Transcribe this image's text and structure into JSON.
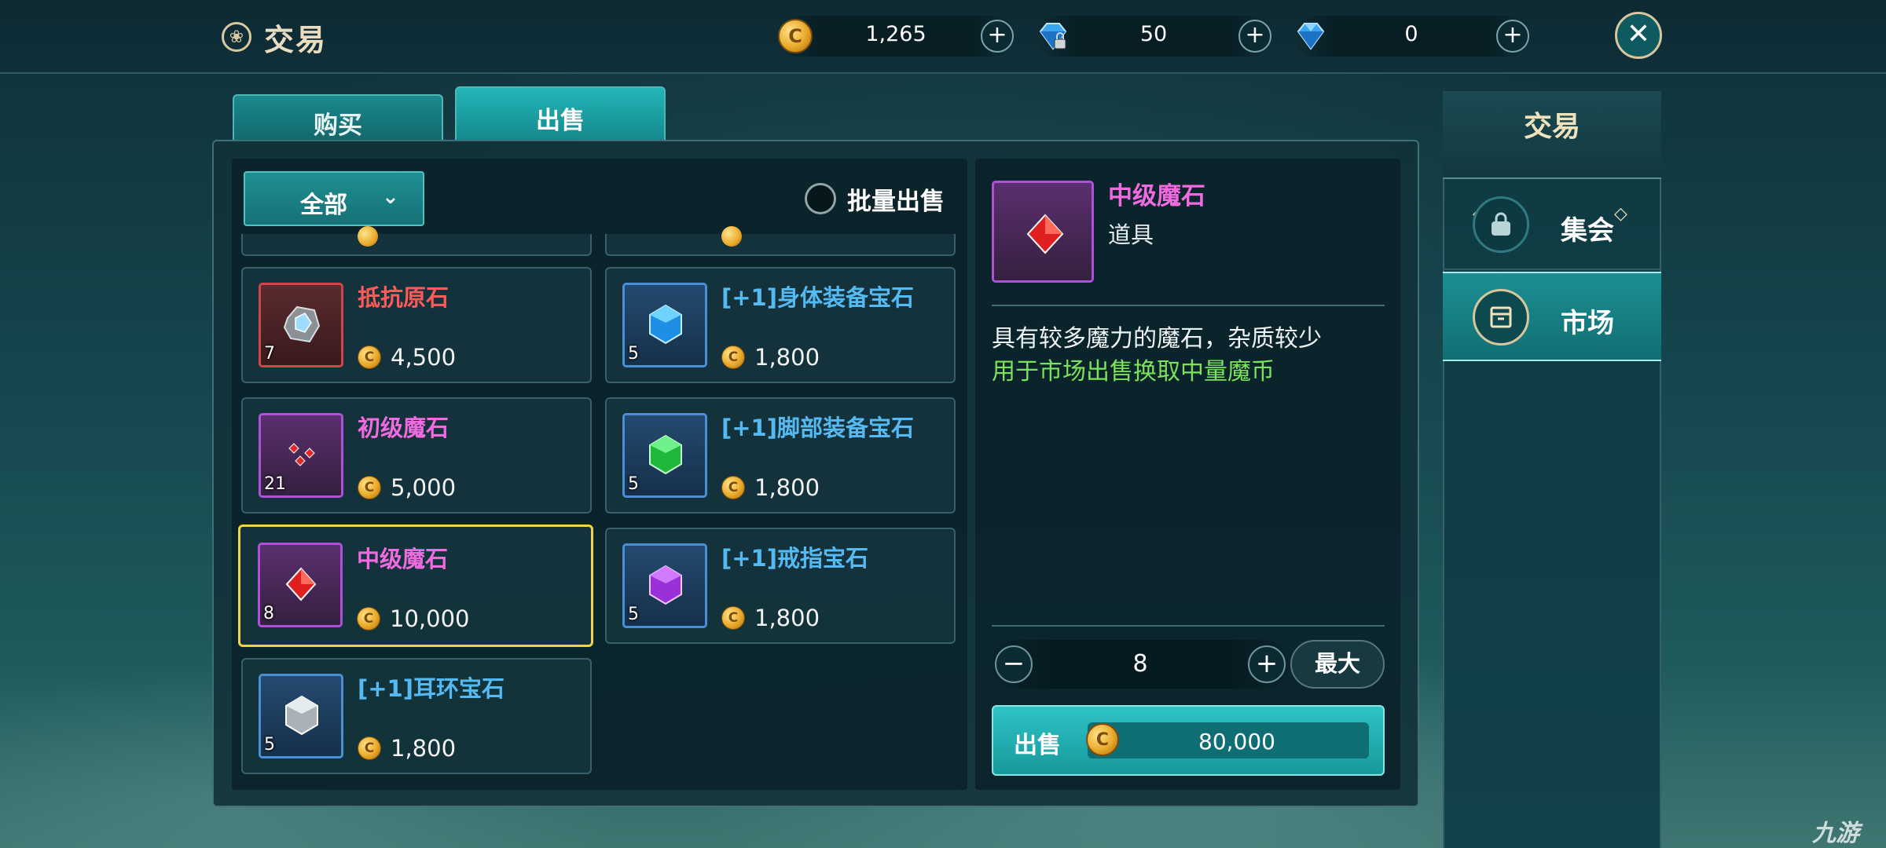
{
  "header": {
    "title": "交易",
    "title_icon": "trade-emblem-icon",
    "currencies": [
      {
        "name": "gold",
        "icon": "gold-coin-icon",
        "value": "1,265",
        "add": "+"
      },
      {
        "name": "bound-diamond",
        "icon": "locked-diamond-icon",
        "value": "50",
        "add": "+"
      },
      {
        "name": "diamond",
        "icon": "diamond-icon",
        "value": "0",
        "add": "+"
      }
    ],
    "close_icon": "close-icon"
  },
  "tabs": [
    {
      "label": "购买",
      "active": false
    },
    {
      "label": "出售",
      "active": true
    }
  ],
  "filter": {
    "selected": "全部",
    "batch_label": "批量出售",
    "batch_checked": false
  },
  "items": [
    {
      "name": "抵抗原石",
      "rarity": "red",
      "count": "7",
      "price": "4,500",
      "icon": "resist-ore-icon"
    },
    {
      "name": "[+1]身体装备宝石",
      "rarity": "blue",
      "count": "5",
      "price": "1,800",
      "icon": "blue-gem-icon"
    },
    {
      "name": "初级魔石",
      "rarity": "purple",
      "count": "21",
      "price": "5,000",
      "icon": "small-magic-stones-icon"
    },
    {
      "name": "[+1]脚部装备宝石",
      "rarity": "blue",
      "count": "5",
      "price": "1,800",
      "icon": "green-gem-icon"
    },
    {
      "name": "中级魔石",
      "rarity": "purple",
      "count": "8",
      "price": "10,000",
      "icon": "red-magic-stone-icon",
      "selected": true
    },
    {
      "name": "[+1]戒指宝石",
      "rarity": "blue",
      "count": "5",
      "price": "1,800",
      "icon": "purple-gem-icon"
    },
    {
      "name": "[+1]耳环宝石",
      "rarity": "blue",
      "count": "5",
      "price": "1,800",
      "icon": "silver-gem-icon"
    }
  ],
  "detail": {
    "name": "中级魔石",
    "type": "道具",
    "icon": "red-magic-stone-icon",
    "description": "具有较多魔力的魔石，杂质较少",
    "usage": "用于市场出售换取中量魔币",
    "quantity": "8",
    "minus": "−",
    "plus": "+",
    "max_label": "最大",
    "sell_label": "出售",
    "sell_total": "80,000"
  },
  "side_nav": {
    "title": "交易",
    "items": [
      {
        "label": "集会",
        "icon": "bag-icon",
        "active": false
      },
      {
        "label": "市场",
        "icon": "shop-stall-icon",
        "active": true
      }
    ]
  },
  "watermark": "九游",
  "colors": {
    "accent_teal": "#1b9a9e",
    "selected_border": "#f1d24a",
    "rarity_red": "#ff5a5a",
    "rarity_purple": "#f06be0",
    "rarity_blue": "#55b9f2",
    "usage_green": "#7be35b"
  }
}
